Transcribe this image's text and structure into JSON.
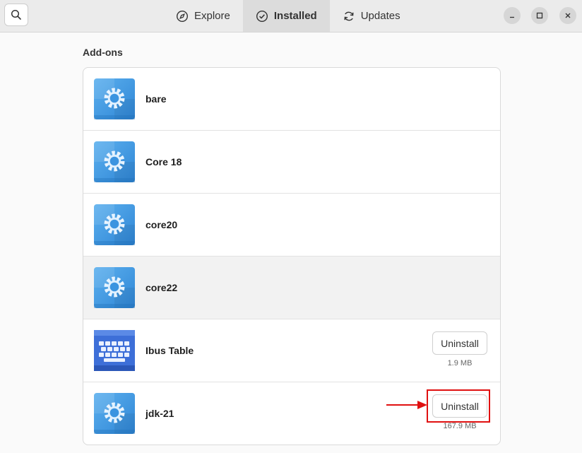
{
  "header": {
    "tabs": [
      {
        "label": "Explore",
        "icon": "compass-icon"
      },
      {
        "label": "Installed",
        "icon": "check-circle-icon"
      },
      {
        "label": "Updates",
        "icon": "refresh-icon"
      }
    ],
    "active_tab": "Installed"
  },
  "section": {
    "title": "Add-ons"
  },
  "apps": [
    {
      "name": "bare",
      "icon": "gear-icon"
    },
    {
      "name": "Core 18",
      "icon": "gear-icon"
    },
    {
      "name": "core20",
      "icon": "gear-icon"
    },
    {
      "name": "core22",
      "icon": "gear-icon"
    },
    {
      "name": "Ibus Table",
      "icon": "keyboard-icon",
      "button": "Uninstall",
      "size": "1.9 MB"
    },
    {
      "name": "jdk-21",
      "icon": "gear-icon",
      "button": "Uninstall",
      "size": "167.9 MB"
    }
  ],
  "colors": {
    "annotation": "#e01010",
    "app_icon_blue": "#3d95df"
  }
}
